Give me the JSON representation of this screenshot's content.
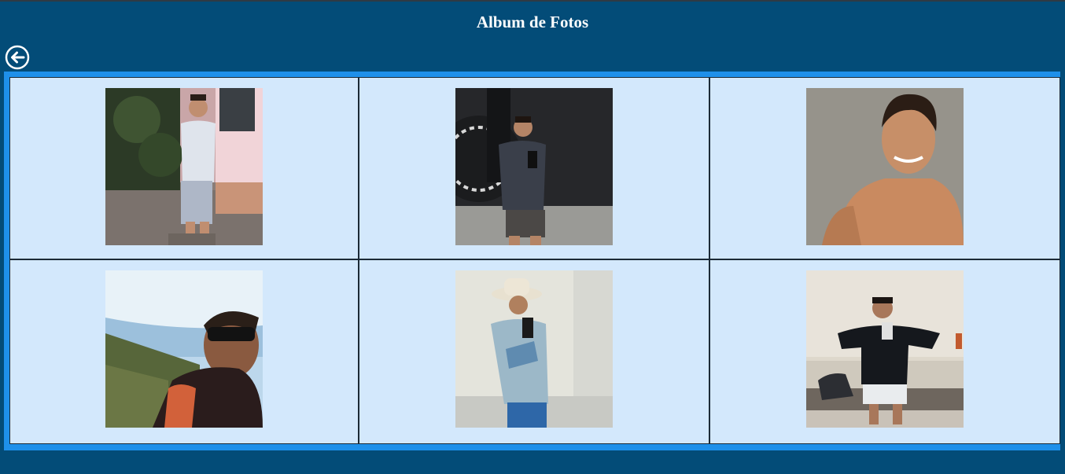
{
  "header": {
    "title": "Album de Fotos"
  },
  "icons": {
    "back": "arrow-left-circle-icon"
  },
  "colors": {
    "background": "#034c78",
    "frame": "#1e90ea",
    "cell_background": "#d3e8fc",
    "grid_lines": "#1c2a36",
    "title_text": "#ffffff"
  },
  "album": {
    "columns": 3,
    "rows": 2,
    "photos": [
      {
        "subject": "standing-outdoor-evening"
      },
      {
        "subject": "mirror-selfie-gym"
      },
      {
        "subject": "smiling-shirtless-portrait"
      },
      {
        "subject": "selfie-sunglasses-lake"
      },
      {
        "subject": "cowboy-hat-mirror-selfie"
      },
      {
        "subject": "mirror-selfie-bedroom"
      }
    ]
  }
}
